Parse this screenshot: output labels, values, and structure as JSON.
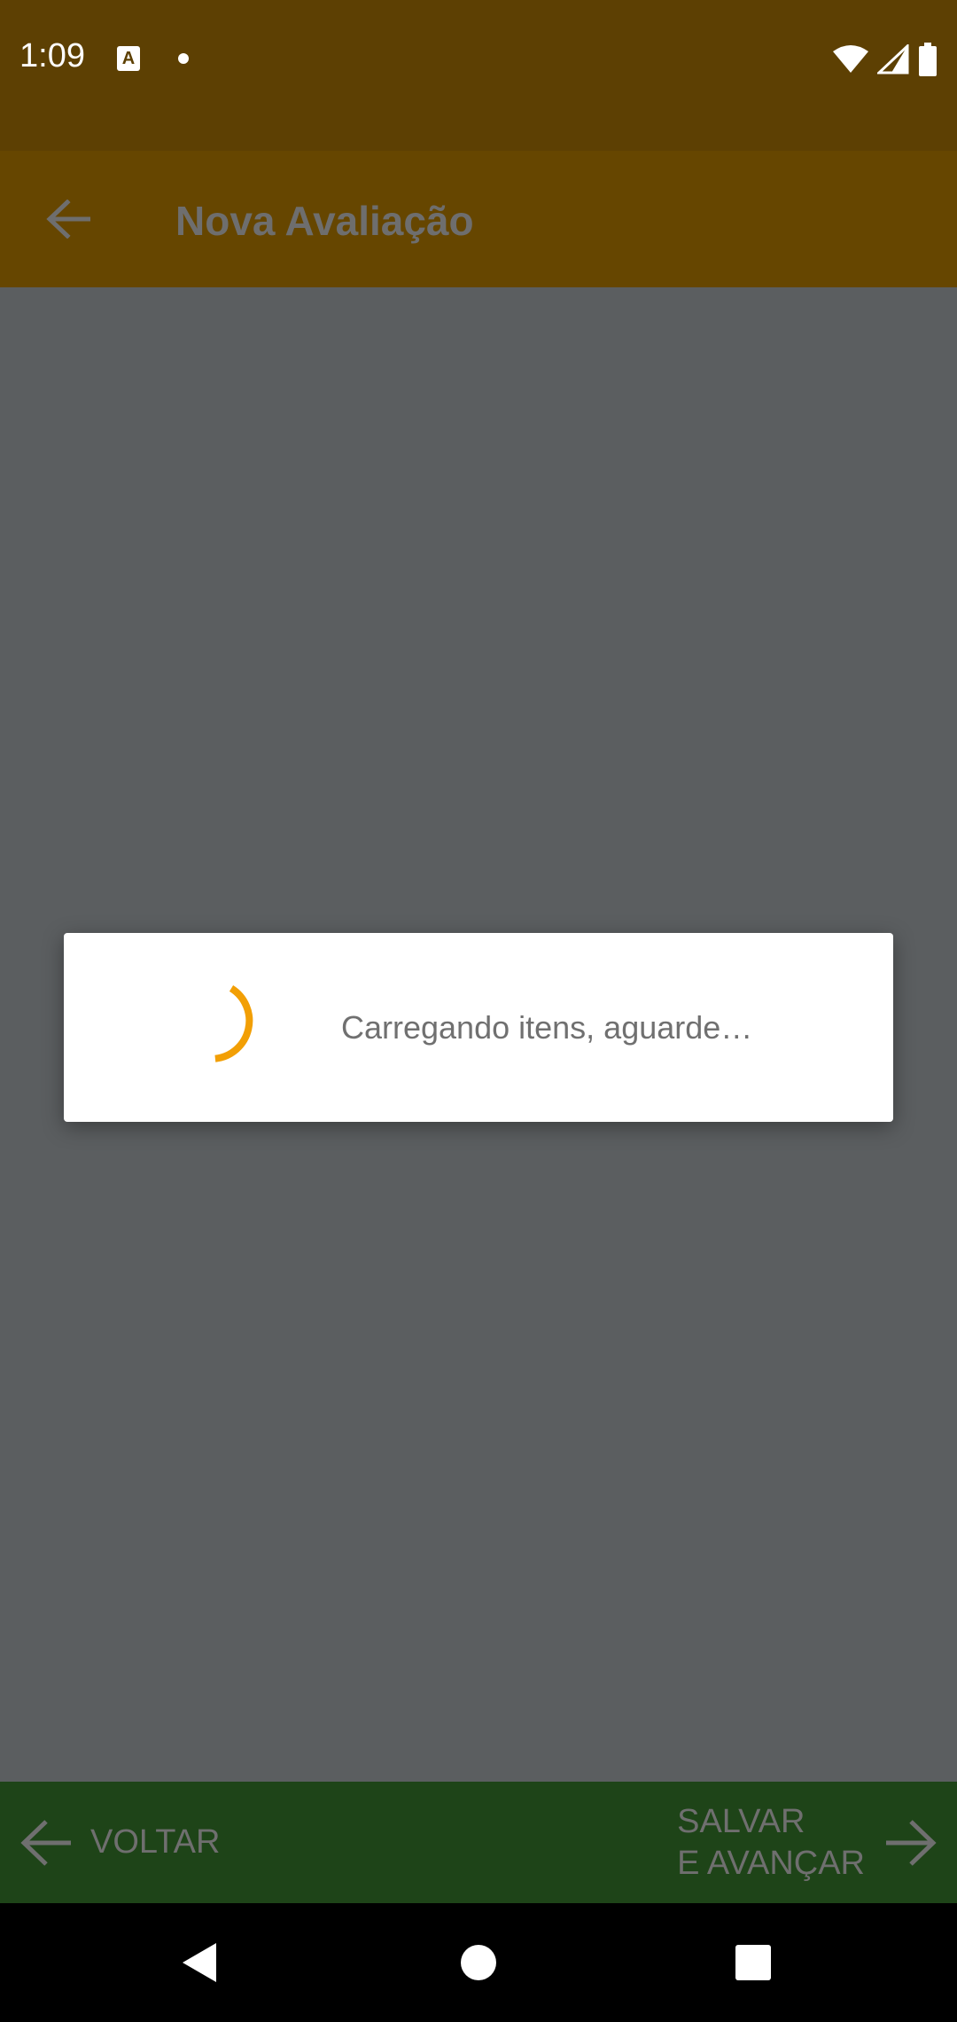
{
  "status_bar": {
    "time": "1:09",
    "app_icon_letter": "A",
    "icons": [
      "a-notification-icon",
      "dot-icon",
      "wifi-icon",
      "signal-icon",
      "battery-icon"
    ]
  },
  "app_bar": {
    "title": "Nova Avaliação",
    "back_icon": "arrow-back-icon"
  },
  "dialog": {
    "message": "Carregando itens, aguarde…",
    "spinner_color": "#f29f05"
  },
  "bottom_bar": {
    "back_label": "VOLTAR",
    "next_label_line1": "SALVAR",
    "next_label_line2": "E AVANÇAR"
  },
  "nav_bar": {
    "icons": [
      "back-triangle-icon",
      "home-circle-icon",
      "recents-square-icon"
    ]
  },
  "colors": {
    "status_bar": "#5d4003",
    "app_bar": "#664600",
    "scrim_background": "#5b5e60",
    "bottom_bar": "#1e4418",
    "accent": "#f29f05"
  }
}
